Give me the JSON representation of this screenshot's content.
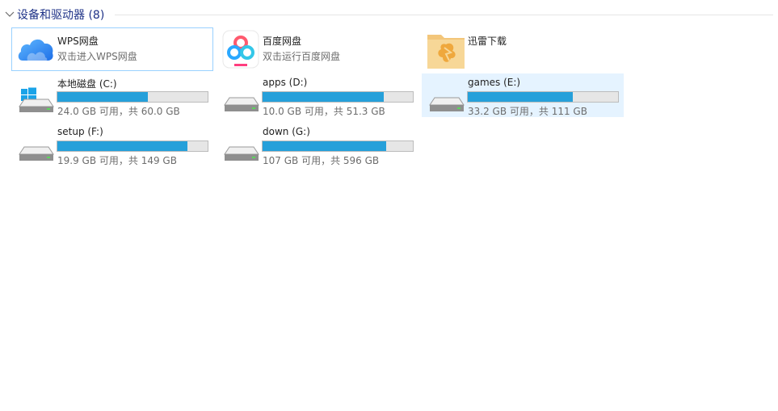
{
  "section": {
    "title": "设备和驱动器 (8)"
  },
  "apps": [
    {
      "name": "WPS网盘",
      "desc": "双击进入WPS网盘",
      "icon": "wps-cloud-icon"
    },
    {
      "name": "百度网盘",
      "desc": "双击运行百度网盘",
      "icon": "baidu-netdisk-icon"
    },
    {
      "name": "迅雷下载",
      "desc": "",
      "icon": "thunder-folder-icon"
    }
  ],
  "drives": [
    {
      "name": "本地磁盘 (C:)",
      "space": "24.0 GB 可用，共 60.0 GB",
      "used_fraction": 0.6,
      "icon": "windows-drive-icon"
    },
    {
      "name": "apps (D:)",
      "space": "10.0 GB 可用，共 51.3 GB",
      "used_fraction": 0.805,
      "icon": "hard-drive-icon"
    },
    {
      "name": "games (E:)",
      "space": "33.2 GB 可用，共 111 GB",
      "used_fraction": 0.701,
      "icon": "hard-drive-icon"
    },
    {
      "name": "setup (F:)",
      "space": "19.9 GB 可用，共 149 GB",
      "used_fraction": 0.866,
      "icon": "hard-drive-icon"
    },
    {
      "name": "down (G:)",
      "space": "107 GB 可用，共 596 GB",
      "used_fraction": 0.82,
      "icon": "hard-drive-icon"
    }
  ],
  "colors": {
    "bar_fill": "#26a0da",
    "bar_track": "#e6e6e6",
    "header": "#1e3287",
    "selection": "#e5f3ff"
  }
}
